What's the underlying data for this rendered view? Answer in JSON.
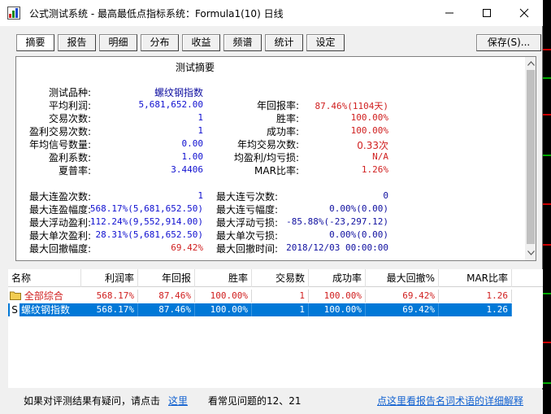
{
  "window": {
    "title": "公式测试系统 - 最高最低点指标系统：Formula1(10) 日线"
  },
  "tabs": [
    {
      "label": "摘要",
      "active": true
    },
    {
      "label": "报告"
    },
    {
      "label": "明细"
    },
    {
      "label": "分布"
    },
    {
      "label": "收益"
    },
    {
      "label": "频谱"
    },
    {
      "label": "统计"
    },
    {
      "label": "设定"
    }
  ],
  "toolbar": {
    "save_label": "保存(S)..."
  },
  "summary": {
    "title": "测试摘要",
    "left": [
      {
        "label": "测试品种:",
        "value": "螺纹钢指数"
      },
      {
        "label": "平均利润:",
        "value": "5,681,652.00"
      },
      {
        "label": "交易次数:",
        "value": "1"
      },
      {
        "label": "盈利交易次数:",
        "value": "1"
      },
      {
        "label": "年均信号数量:",
        "value": "0.00"
      },
      {
        "label": "盈利系数:",
        "value": "1.00"
      },
      {
        "label": "夏普率:",
        "value": "3.4406"
      }
    ],
    "right": [
      {
        "label": "年回报率:",
        "value": "87.46%(1104天)"
      },
      {
        "label": "胜率:",
        "value": "100.00%"
      },
      {
        "label": "成功率:",
        "value": "100.00%"
      },
      {
        "label": "年均交易次数:",
        "value": "0.33次"
      },
      {
        "label": "均盈利/均亏损:",
        "value": "N/A"
      },
      {
        "label": "MAR比率:",
        "value": "1.26%"
      }
    ],
    "left2": [
      {
        "label": "最大连盈次数:",
        "value": "1"
      },
      {
        "label": "最大连盈幅度:",
        "value": "568.17%(5,681,652.50)"
      },
      {
        "label": "最大浮动盈利:",
        "value": "112.24%(9,552,914.00)"
      },
      {
        "label": "最大单次盈利:",
        "value": "28.31%(5,681,652.50)"
      },
      {
        "label": "最大回撤幅度:",
        "value": "69.42%"
      }
    ],
    "right2": [
      {
        "label": "最大连亏次数:",
        "value": "0"
      },
      {
        "label": "最大连亏幅度:",
        "value": "0.00%(0.00)"
      },
      {
        "label": "最大浮动亏损:",
        "value": "-85.88%(-23,297.12)"
      },
      {
        "label": "最大单次亏损:",
        "value": "0.00%(0.00)"
      },
      {
        "label": "最大回撤时间:",
        "value": "2018/12/03 00:00:00"
      }
    ]
  },
  "table": {
    "columns": [
      "名称",
      "利润率",
      "年回报",
      "胜率",
      "交易数",
      "成功率",
      "最大回撤%",
      "MAR比率"
    ],
    "rows": [
      {
        "name": "全部综合",
        "cells": [
          "568.17%",
          "87.46%",
          "100.00%",
          "1",
          "100.00%",
          "69.42%",
          "1.26"
        ]
      },
      {
        "name": "螺纹钢指数",
        "prefix": "S",
        "cells": [
          "568.17%",
          "87.46%",
          "100.00%",
          "1",
          "100.00%",
          "69.42%",
          "1.26"
        ]
      }
    ]
  },
  "status": {
    "question_text": "如果对评测结果有疑问，请点击",
    "here_link": "这里",
    "faq_text": "看常见问题的12、21",
    "glossary_link": "点这里看报告名词术语的详细解释"
  }
}
